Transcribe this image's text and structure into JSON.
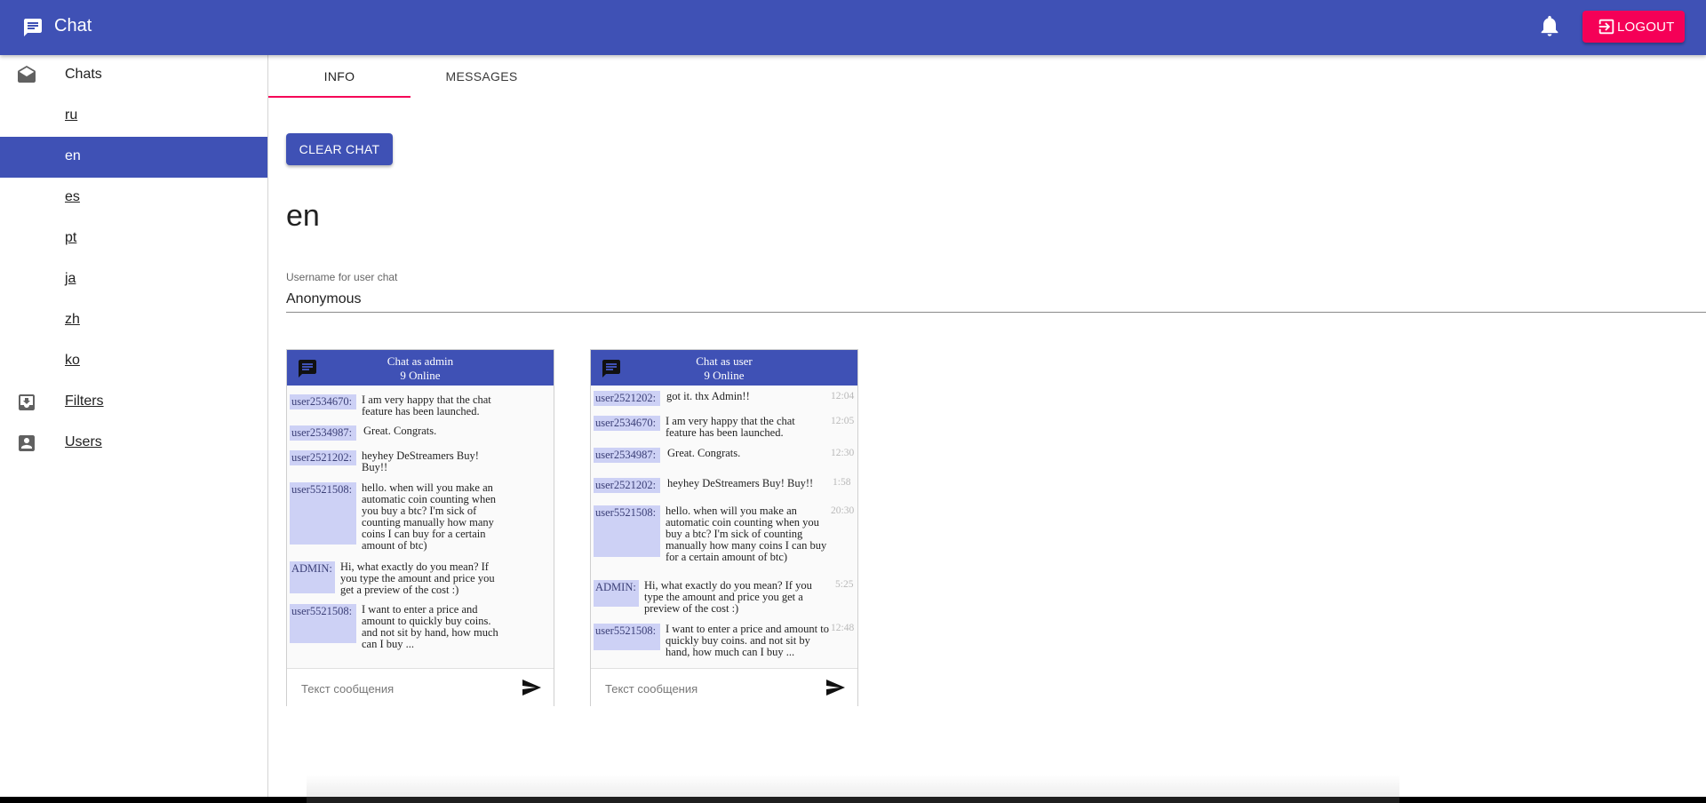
{
  "appbar": {
    "title": "Chat",
    "logout_label": "LOGOUT"
  },
  "sidebar": {
    "chats_label": "Chats",
    "rooms": [
      "ru",
      "en",
      "es",
      "pt",
      "ja",
      "zh",
      "ko"
    ],
    "selected_room": "en",
    "filters_label": "Filters",
    "users_label": "Users"
  },
  "tabs": [
    "INFO",
    "MESSAGES"
  ],
  "active_tab": "INFO",
  "info": {
    "clear_label": "CLEAR CHAT",
    "chat_name": "en",
    "username_label": "Username for user chat",
    "username_value": "Anonymous"
  },
  "admin_widget": {
    "title": "Chat as admin",
    "online": "9 Online",
    "placeholder": "Текст сообщения",
    "messages": [
      {
        "user": "user2534670:",
        "text": "I am very happy that the chat feature has been launched."
      },
      {
        "user": "user2534987:",
        "text": "Great. Congrats."
      },
      {
        "user": "user2521202:",
        "text": "heyhey DeStreamers Buy! Buy!!"
      },
      {
        "user": "user5521508:",
        "text": "hello. when will you make an automatic coin counting when you buy a btc? I'm sick of counting manually how many coins I can buy for a certain amount of btc)"
      },
      {
        "user": "ADMIN:",
        "text": "Hi, what exactly do you mean? If you type the amount and price you get a preview of the cost :)"
      },
      {
        "user": "user5521508:",
        "text": "I want to enter a price and amount to quickly buy coins. and not sit by hand, how much can I buy ..."
      }
    ]
  },
  "user_widget": {
    "title": "Chat as user",
    "online": "9 Online",
    "placeholder": "Текст сообщения",
    "messages": [
      {
        "user": "user2521202:",
        "text": "got it. thx Admin!!",
        "time": "12:04"
      },
      {
        "user": "user2534670:",
        "text": "I am very happy that the chat feature has been launched.",
        "time": "12:05"
      },
      {
        "user": "user2534987:",
        "text": "Great. Congrats.",
        "time": "12:30"
      },
      {
        "user": "user2521202:",
        "text": "heyhey DeStreamers Buy! Buy!!",
        "time": "1:58"
      },
      {
        "user": "user5521508:",
        "text": "hello. when will you make an automatic coin counting when you buy a btc? I'm sick of counting manually how many coins I can buy for a certain amount of btc)",
        "time": "20:30"
      },
      {
        "user": "ADMIN:",
        "text": "Hi, what exactly do you mean? If you type the amount and price you get a preview of the cost :)",
        "time": "5:25"
      },
      {
        "user": "user5521508:",
        "text": "I want to enter a price and amount to quickly buy coins. and not sit by hand, how much can I buy ...",
        "time": "12:48"
      }
    ]
  },
  "colors": {
    "primary": "#3f51b5",
    "accent": "#f50057",
    "username_bg": "#cdd1f5"
  }
}
